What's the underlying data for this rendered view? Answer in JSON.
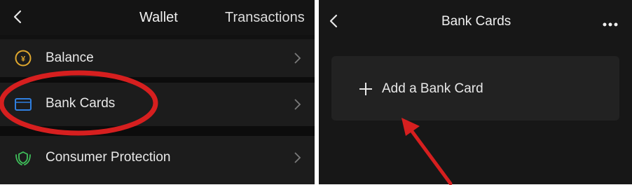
{
  "left": {
    "header": {
      "title": "Wallet",
      "right_link": "Transactions"
    },
    "items": [
      {
        "label": "Balance",
        "icon": "yen-coin-icon"
      },
      {
        "label": "Bank Cards",
        "icon": "card-icon"
      },
      {
        "label": "Consumer Protection",
        "icon": "hands-shield-icon"
      }
    ]
  },
  "right": {
    "header": {
      "title": "Bank Cards"
    },
    "add_card_label": "Add a Bank Card"
  },
  "colors": {
    "annotation_red": "#d61f1f",
    "balance_icon": "#e0a82e",
    "card_icon": "#2f7fe0",
    "protection_icon": "#3fbf5a"
  }
}
